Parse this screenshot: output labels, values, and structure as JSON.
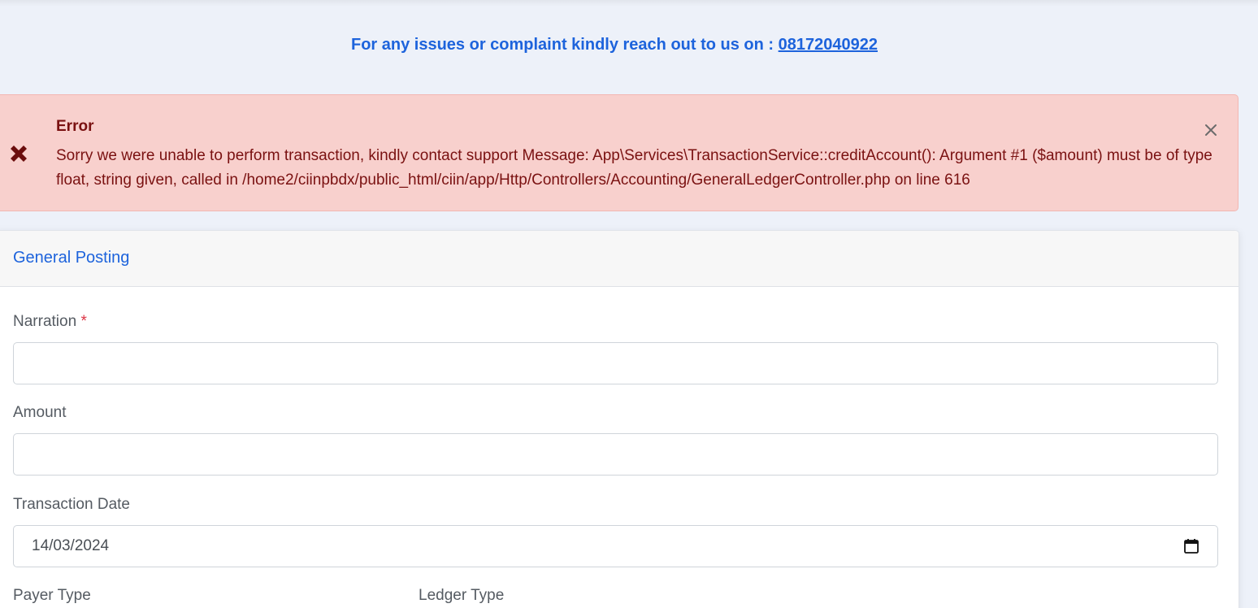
{
  "support": {
    "text": "For any issues or complaint kindly reach out to us on : ",
    "phone": "08172040922"
  },
  "alert": {
    "icon": "x-mark-icon",
    "title": "Error",
    "message": "Sorry we were unable to perform transaction, kindly contact support Message: App\\Services\\TransactionService::creditAccount(): Argument #1 ($amount) must be of type float, string given, called in /home2/ciinpbdx/public_html/ciin/app/Http/Controllers/Accounting/GeneralLedgerController.php on line 616",
    "close_icon": "close-icon"
  },
  "form": {
    "title": "General Posting",
    "narration": {
      "label": "Narration",
      "required_mark": "*",
      "value": ""
    },
    "amount": {
      "label": "Amount",
      "value": ""
    },
    "transaction_date": {
      "label": "Transaction Date",
      "value": "14/03/2024",
      "icon": "calendar-icon"
    },
    "payer_type": {
      "label": "Payer Type"
    },
    "ledger_type": {
      "label": "Ledger Type"
    }
  },
  "colors": {
    "accent": "#1d63dc",
    "alert_bg": "#f8d0cd",
    "alert_text": "#7a1111",
    "page_bg": "#edf1f9"
  }
}
